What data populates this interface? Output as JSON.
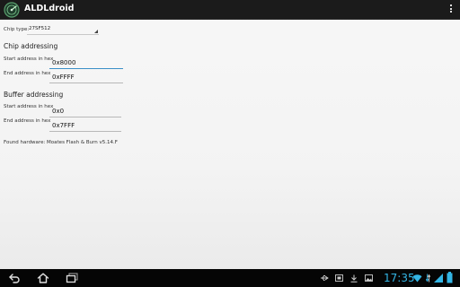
{
  "app": {
    "title": "ALDLdroid"
  },
  "chip_type": {
    "label": "Chip type:",
    "value": "27SF512"
  },
  "chip_addressing": {
    "header": "Chip addressing",
    "start_label": "Start address in hex",
    "start_value": "0x8000",
    "end_label": "End address in hex",
    "end_value": "0xFFFF"
  },
  "buffer_addressing": {
    "header": "Buffer addressing",
    "start_label": "Start address in hex",
    "start_value": "0x0",
    "end_label": "End address in hex",
    "end_value": "0x7FFF"
  },
  "hardware_status": "Found hardware: Moates Flash & Burn v5.14.F",
  "status_bar": {
    "time": "17:35",
    "accent_color": "#33b5e5",
    "icons": [
      "usb-icon",
      "screenshot-icon",
      "download-icon",
      "gallery-icon",
      "wifi-icon",
      "battery-icon"
    ]
  },
  "nav_bar": {
    "icons": [
      "back-icon",
      "home-icon",
      "recent-apps-icon"
    ]
  }
}
